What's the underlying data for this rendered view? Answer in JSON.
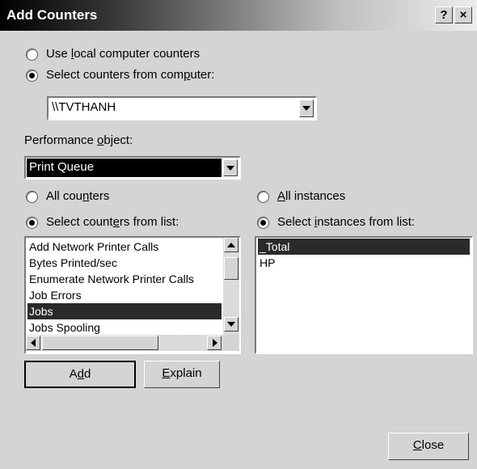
{
  "window": {
    "title": "Add Counters",
    "help_button": "?",
    "close_button": "×"
  },
  "computer_source": {
    "options": [
      {
        "label_pre": "Use ",
        "label_key": "l",
        "label_post": "ocal computer counters",
        "selected": false
      },
      {
        "label_pre": "Select counters from com",
        "label_key": "p",
        "label_post": "uter:",
        "selected": true
      }
    ],
    "computer_value": "\\\\TVTHANH"
  },
  "performance_object": {
    "label_pre": "Performance ",
    "label_key": "o",
    "label_post": "bject:",
    "value": "Print Queue"
  },
  "counter_options": [
    {
      "label_pre": "All cou",
      "label_key": "n",
      "label_post": "ters",
      "selected": false
    },
    {
      "label_pre": "Select count",
      "label_key": "e",
      "label_post": "rs from list:",
      "selected": true
    }
  ],
  "instance_options": [
    {
      "label_pre": "",
      "label_key": "A",
      "label_post": "ll instances",
      "selected": false
    },
    {
      "label_pre": "Select ",
      "label_key": "i",
      "label_post": "nstances from list:",
      "selected": true
    }
  ],
  "counters_list": {
    "items": [
      "Add Network Printer Calls",
      "Bytes Printed/sec",
      "Enumerate Network Printer Calls",
      "Job Errors",
      "Jobs",
      "Jobs Spooling"
    ],
    "selected": "Jobs"
  },
  "instances_list": {
    "items": [
      "_Total",
      "HP"
    ],
    "selected": "_Total"
  },
  "buttons": {
    "add": {
      "pre": "A",
      "key": "d",
      "post": "d"
    },
    "explain": {
      "pre": "",
      "key": "E",
      "post": "xplain"
    },
    "close": {
      "pre": "",
      "key": "C",
      "post": "lose"
    }
  }
}
